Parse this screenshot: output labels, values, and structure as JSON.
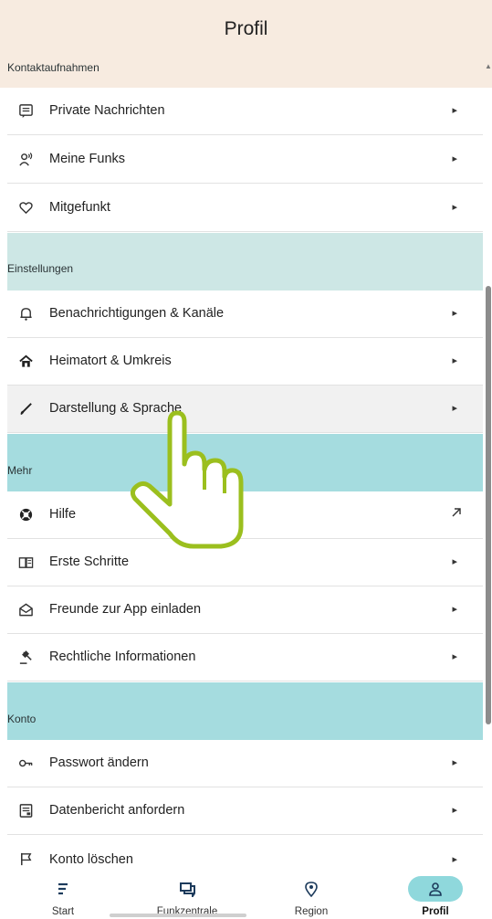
{
  "header": {
    "title": "Profil"
  },
  "sections": {
    "kontakt": "Kontaktaufnahmen",
    "einstellungen": "Einstellungen",
    "mehr": "Mehr",
    "konto": "Konto"
  },
  "items": {
    "private_nachrichten": "Private Nachrichten",
    "meine_funks": "Meine Funks",
    "mitgefunkt": "Mitgefunkt",
    "benachrichtigungen": "Benachrichtigungen & Kanäle",
    "heimatort": "Heimatort & Umkreis",
    "darstellung": "Darstellung & Sprache",
    "hilfe": "Hilfe",
    "erste_schritte": "Erste Schritte",
    "freunde": "Freunde zur App einladen",
    "rechtliches": "Rechtliche Informationen",
    "passwort": "Passwort ändern",
    "datenbericht": "Datenbericht anfordern",
    "konto_loeschen": "Konto löschen"
  },
  "chevron": "▸",
  "nav": {
    "start": "Start",
    "funkzentrale": "Funkzentrale",
    "region": "Region",
    "profil": "Profil"
  },
  "colors": {
    "header_bg": "#f7ebe0",
    "section_mint": "#cde7e5",
    "section_teal": "#a5dcdf",
    "nav_selected": "#8fd8dc",
    "hand_outline": "#9bbf1e"
  },
  "icons": {
    "private_nachrichten": "message-icon",
    "meine_funks": "broadcast-person-icon",
    "mitgefunkt": "heart-icon",
    "benachrichtigungen": "bell-icon",
    "heimatort": "home-icon",
    "darstellung": "brush-icon",
    "hilfe": "lifebuoy-icon",
    "hilfe_action": "external-arrow-icon",
    "erste_schritte": "book-icon",
    "freunde": "mail-open-icon",
    "rechtliches": "gavel-icon",
    "passwort": "key-icon",
    "datenbericht": "report-icon",
    "konto_loeschen": "flag-icon",
    "nav_start": "feed-icon",
    "nav_funkzentrale": "chat-icon",
    "nav_region": "location-pin-icon",
    "nav_profil": "person-icon",
    "pointer": "pointing-hand-icon"
  }
}
